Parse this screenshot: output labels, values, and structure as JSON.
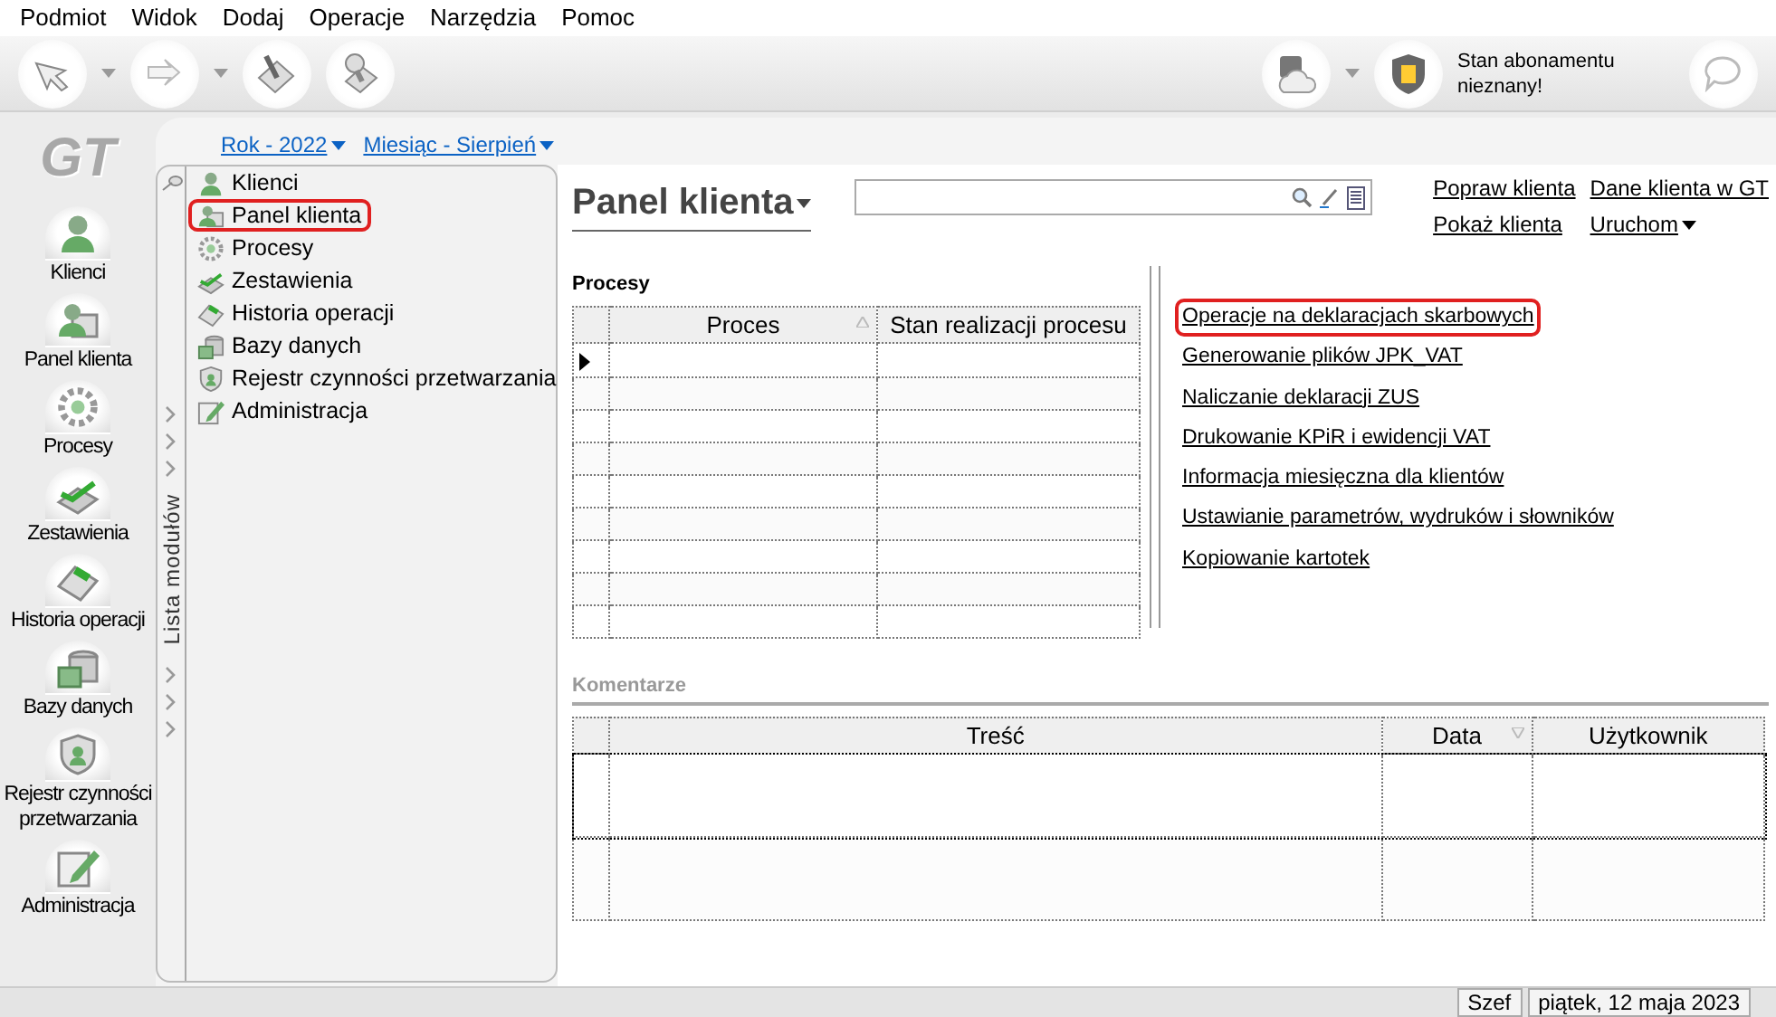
{
  "menu": [
    "Podmiot",
    "Widok",
    "Dodaj",
    "Operacje",
    "Narzędzia",
    "Pomoc"
  ],
  "subscription": "Stan abonamentu nieznany!",
  "logo": "GT",
  "sidebar": {
    "items": [
      {
        "label": "Klienci",
        "kind": "person"
      },
      {
        "label": "Panel klienta",
        "kind": "panel"
      },
      {
        "label": "Procesy",
        "kind": "gear"
      },
      {
        "label": "Zestawienia",
        "kind": "chart"
      },
      {
        "label": "Historia operacji",
        "kind": "doc"
      },
      {
        "label": "Bazy danych",
        "kind": "db"
      },
      {
        "label": "Rejestr czynności przetwarzania",
        "kind": "shield"
      },
      {
        "label": "Administracja",
        "kind": "edit"
      }
    ]
  },
  "period": [
    "Rok - 2022",
    "Miesiąc - Sierpień"
  ],
  "module_list": {
    "label": "Lista modułów",
    "items": [
      {
        "label": "Klienci",
        "kind": "person",
        "highlighted": false
      },
      {
        "label": "Panel klienta",
        "kind": "panel",
        "highlighted": true
      },
      {
        "label": "Procesy",
        "kind": "gear",
        "highlighted": false
      },
      {
        "label": "Zestawienia",
        "kind": "chart",
        "highlighted": false
      },
      {
        "label": "Historia operacji",
        "kind": "doc",
        "highlighted": false
      },
      {
        "label": "Bazy danych",
        "kind": "db",
        "highlighted": false
      },
      {
        "label": "Rejestr czynności przetwarzania",
        "kind": "shield",
        "highlighted": false
      },
      {
        "label": "Administracja",
        "kind": "edit",
        "highlighted": false
      }
    ]
  },
  "panel": {
    "title": "Panel klienta",
    "links": [
      "Popraw klienta",
      "Dane klienta w GT",
      "Pokaż klienta",
      "Uruchom"
    ]
  },
  "processes": {
    "title": "Procesy",
    "columns": [
      "Proces",
      "Stan realizacji procesu"
    ]
  },
  "actions": [
    {
      "label": "Operacje na deklaracjach skarbowych",
      "highlighted": true
    },
    {
      "label": "Generowanie plików JPK_VAT",
      "highlighted": false
    },
    {
      "label": "Naliczanie deklaracji ZUS",
      "highlighted": false
    },
    {
      "label": "Drukowanie KPiR i ewidencji VAT",
      "highlighted": false
    },
    {
      "label": "Informacja miesięczna dla klientów",
      "highlighted": false
    },
    {
      "label": "Ustawianie parametrów, wydruków i słowników",
      "highlighted": false
    },
    {
      "label": "Kopiowanie kartotek",
      "highlighted": false
    }
  ],
  "comments": {
    "title": "Komentarze",
    "columns": [
      "Treść",
      "Data",
      "Użytkownik"
    ]
  },
  "status_bar": [
    "Szef",
    "piątek, 12 maja 2023"
  ]
}
